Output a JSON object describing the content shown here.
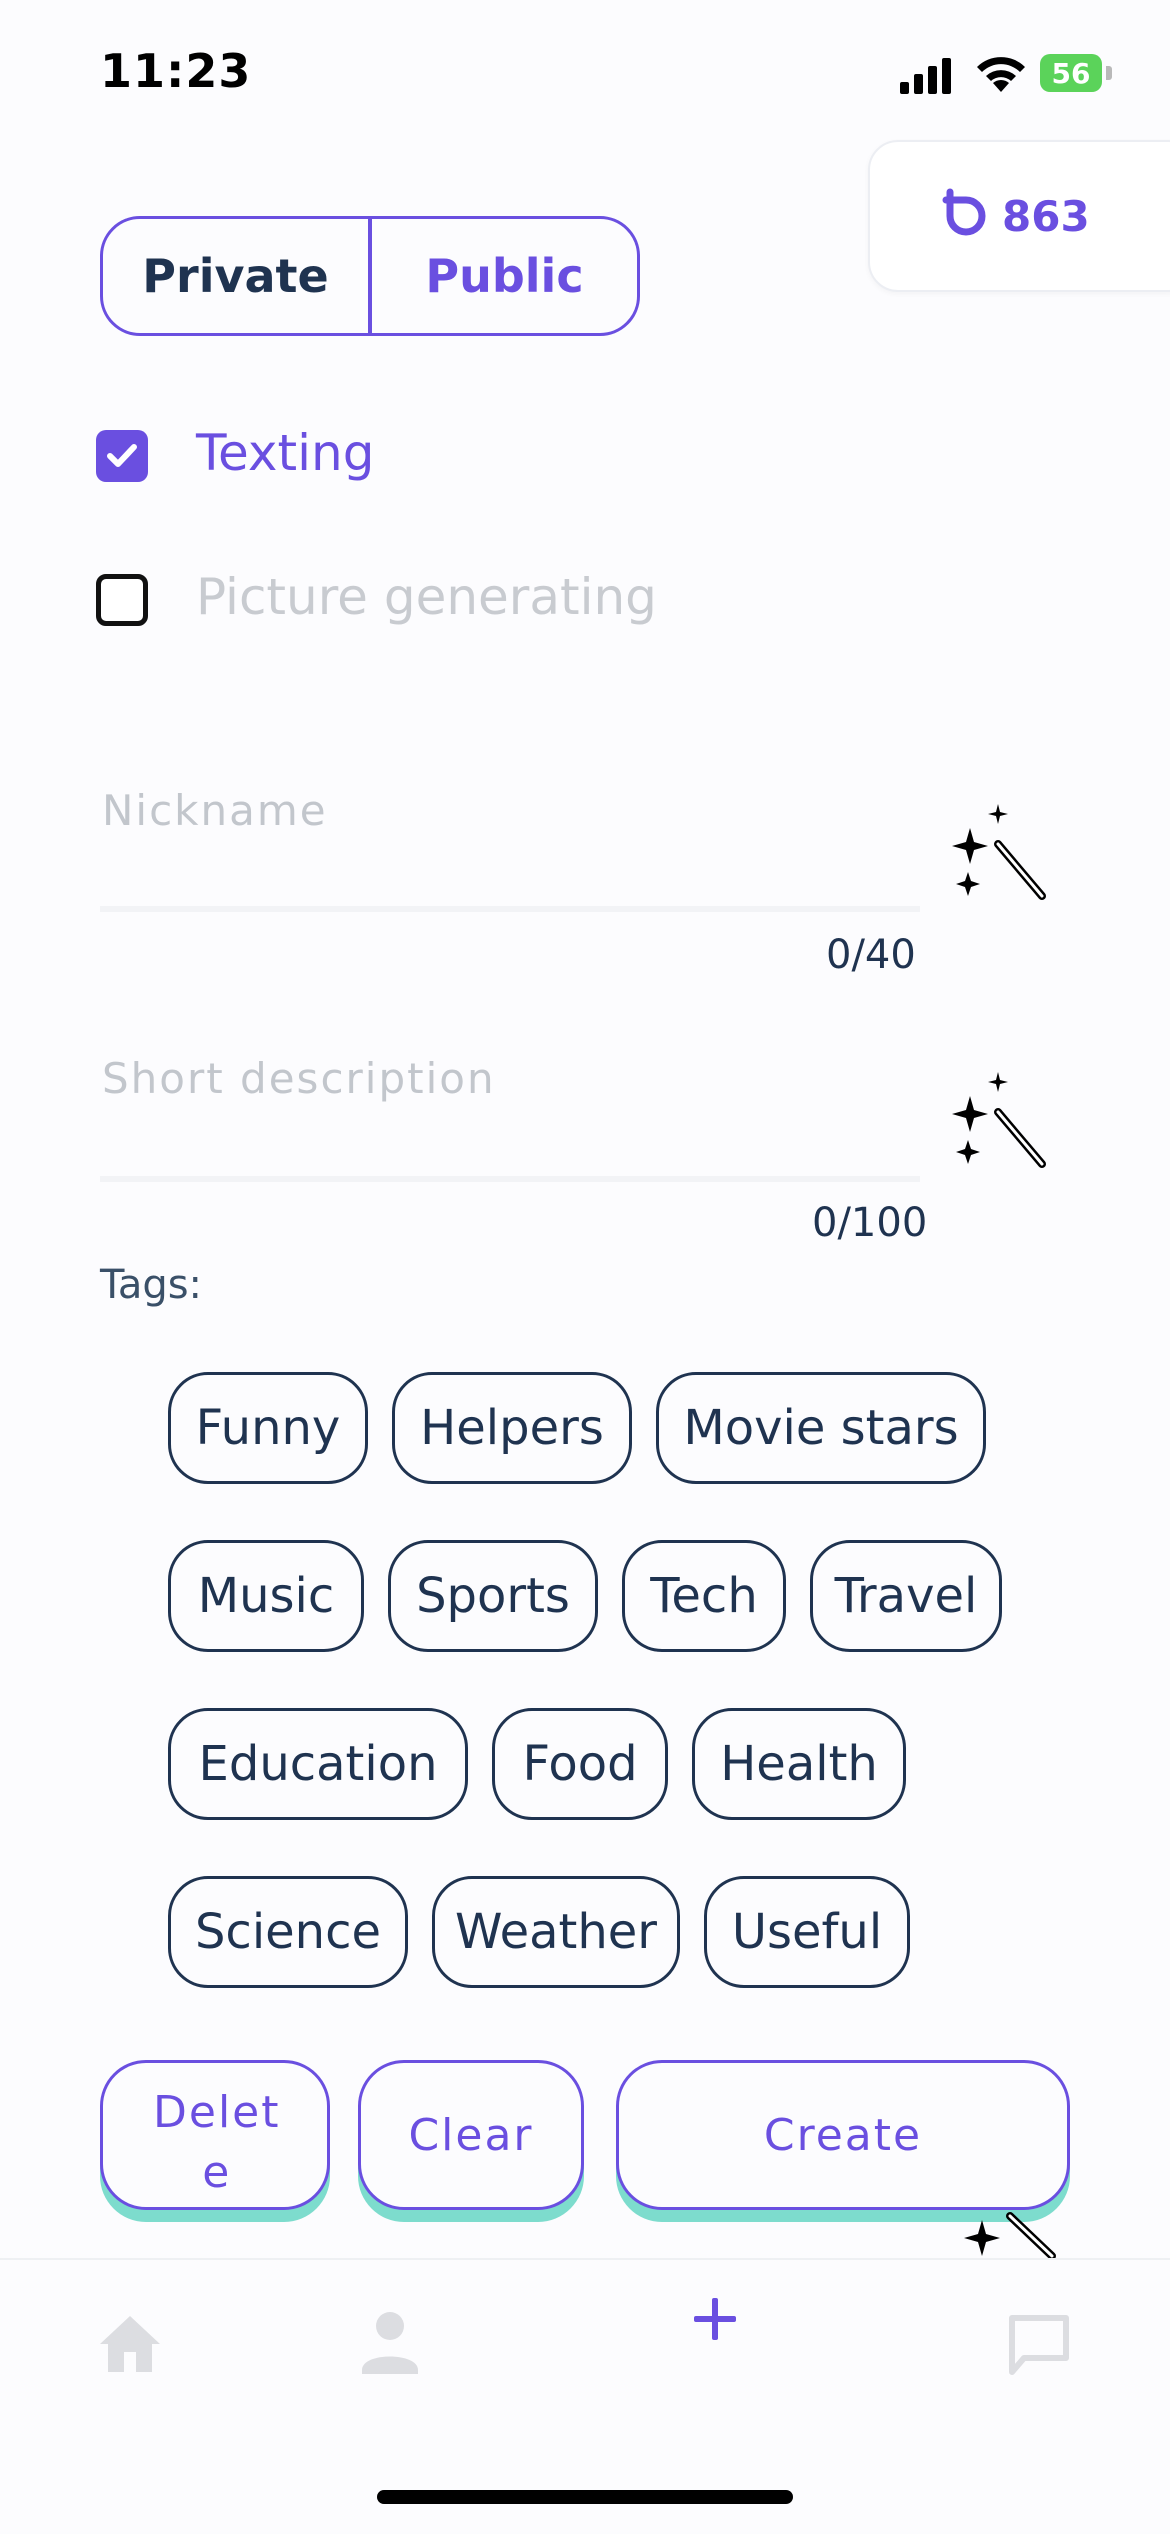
{
  "status_bar": {
    "time": "11:23",
    "battery": "56"
  },
  "coins": {
    "value": "863"
  },
  "visibility": {
    "options": [
      "Private",
      "Public"
    ],
    "selected": "Private"
  },
  "options": {
    "texting": {
      "label": "Texting",
      "checked": true
    },
    "picture": {
      "label": "Picture generating",
      "checked": false
    }
  },
  "fields": {
    "nickname": {
      "placeholder": "Nickname",
      "counter": "0/40"
    },
    "description": {
      "placeholder": "Short description",
      "counter": "0/100"
    }
  },
  "tags": {
    "title": "Tags:",
    "items": [
      "Funny",
      "Helpers",
      "Movie stars",
      "Music",
      "Sports",
      "Tech",
      "Travel",
      "Education",
      "Food",
      "Health",
      "Science",
      "Weather",
      "Useful"
    ]
  },
  "actions": {
    "delete": "Delet\ne",
    "clear": "Clear",
    "create": "Create"
  },
  "colors": {
    "accent": "#6a4fe0",
    "text": "#1f3350",
    "teal": "#7ddccd"
  },
  "tabbar": {
    "icons": [
      "home-icon",
      "profile-icon",
      "plus-icon",
      "chat-icon"
    ],
    "active": "plus-icon"
  }
}
